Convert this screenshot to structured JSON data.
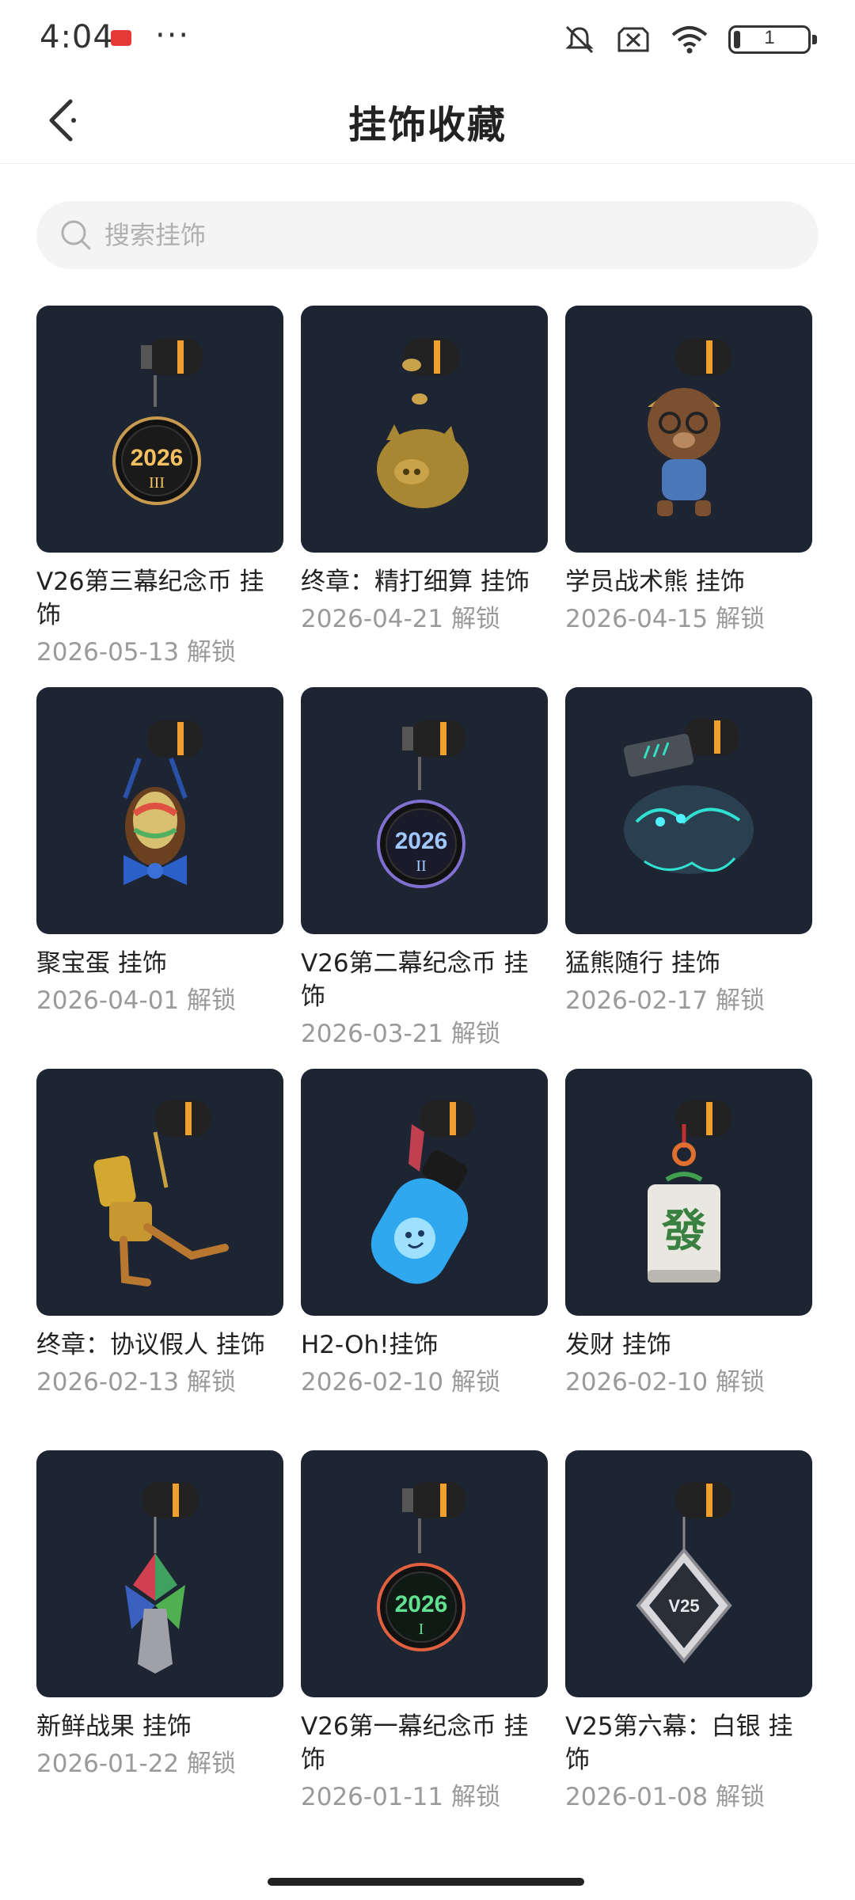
{
  "status": {
    "time": "4:04",
    "dots": "···",
    "battery": "1"
  },
  "header": {
    "title": "挂饰收藏"
  },
  "search": {
    "placeholder": "搜索挂饰"
  },
  "items": [
    {
      "name": "V26第三幕纪念币 挂饰",
      "date": "2026-05-13 解锁",
      "icon": "medal-2026-III-icon"
    },
    {
      "name": "终章：精打细算 挂饰",
      "date": "2026-04-21 解锁",
      "icon": "golden-pig-icon"
    },
    {
      "name": "学员战术熊 挂饰",
      "date": "2026-04-15 解锁",
      "icon": "bear-icon"
    },
    {
      "name": "聚宝蛋 挂饰",
      "date": "2026-04-01 解锁",
      "icon": "egg-bow-icon"
    },
    {
      "name": "V26第二幕纪念币 挂饰",
      "date": "2026-03-21 解锁",
      "icon": "medal-2026-II-icon"
    },
    {
      "name": "猛熊随行 挂饰",
      "date": "2026-02-17 解锁",
      "icon": "blue-beast-icon"
    },
    {
      "name": "终章：协议假人 挂饰",
      "date": "2026-02-13 解锁",
      "icon": "golden-robot-icon"
    },
    {
      "name": "H2-Oh!挂饰",
      "date": "2026-02-10 解锁",
      "icon": "water-bottle-icon"
    },
    {
      "name": "发财 挂饰",
      "date": "2026-02-10 解锁",
      "icon": "mahjong-tile-icon"
    },
    {
      "name": "新鲜战果 挂饰",
      "date": "2026-01-22 解锁",
      "icon": "leaf-flower-icon"
    },
    {
      "name": "V26第一幕纪念币 挂饰",
      "date": "2026-01-11 解锁",
      "icon": "medal-2026-I-icon"
    },
    {
      "name": "V25第六幕：白银 挂饰",
      "date": "2026-01-08 解锁",
      "icon": "silver-diamond-icon"
    }
  ],
  "labels": {
    "medal_3_year": "2026",
    "medal_3_roman": "III",
    "medal_2_year": "2026",
    "medal_2_roman": "II",
    "medal_1_year": "2026",
    "medal_1_roman": "I",
    "mahjong_char": "發",
    "silver_text": "V25"
  },
  "colors": {
    "thumb_bg": "#1d2533",
    "accent_orange": "#f0a030"
  }
}
